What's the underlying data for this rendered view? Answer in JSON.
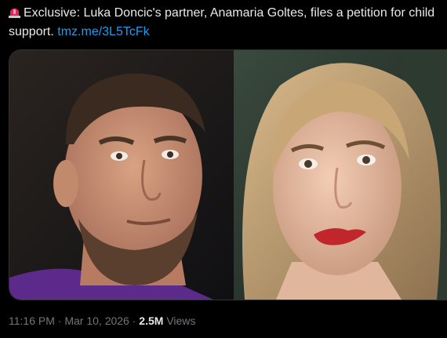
{
  "tweet": {
    "emoji_icon": "police-siren-icon",
    "text": "Exclusive: Luka Doncic's partner, Anamaria Goltes, files a petition for child support.",
    "link": "tmz.me/3L5TcFk"
  },
  "media": {
    "alt_subjects": [
      "man-photo",
      "woman-photo"
    ]
  },
  "meta": {
    "time": "11:16 PM",
    "separator": "·",
    "date": "Mar 10, 2026",
    "views_count": "2.5M",
    "views_label": "Views"
  },
  "colors": {
    "background": "#000000",
    "text": "#e7e9ea",
    "link": "#1d9bf0",
    "muted": "#71767b",
    "border": "#2f3336"
  }
}
